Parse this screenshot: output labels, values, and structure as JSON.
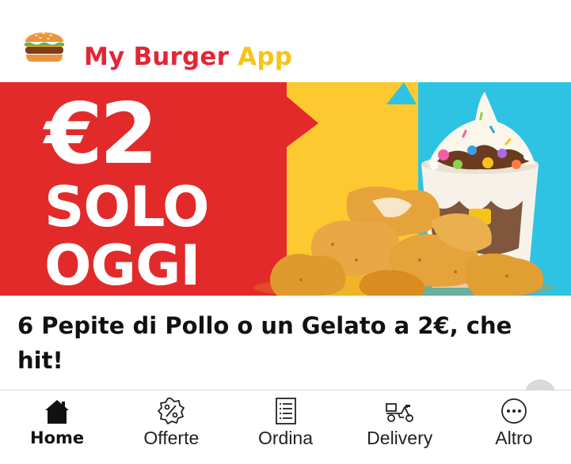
{
  "header": {
    "logo_icon": "burger-icon",
    "title_part1": "My Burger",
    "title_part2": "App",
    "title_color_part1": "#e32636",
    "title_color_part2": "#f7c31a"
  },
  "banner": {
    "price": "€2",
    "line1": "SOLO",
    "line2": "OGGI",
    "colors": {
      "red": "#e32a2a",
      "yellow": "#fcc930",
      "blue": "#2ec3e3"
    }
  },
  "headline": "6 Pepite di Pollo o un Gelato a 2€, che hit!",
  "nav": {
    "items": [
      {
        "label": "Home",
        "icon": "home-icon",
        "active": true
      },
      {
        "label": "Offerte",
        "icon": "discount-icon",
        "active": false
      },
      {
        "label": "Ordina",
        "icon": "menu-list-icon",
        "active": false
      },
      {
        "label": "Delivery",
        "icon": "scooter-icon",
        "active": false
      },
      {
        "label": "Altro",
        "icon": "more-icon",
        "active": false
      }
    ]
  }
}
